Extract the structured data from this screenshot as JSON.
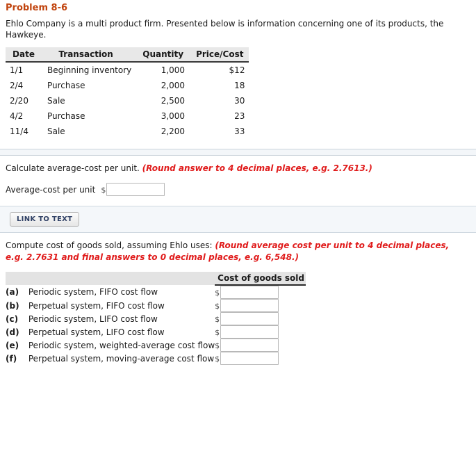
{
  "problem": {
    "title": "Problem 8-6",
    "intro": "Ehlo Company is a multi product firm. Presented below is information concerning one of its products, the Hawkeye."
  },
  "inventory_table": {
    "columns": [
      "Date",
      "Transaction",
      "Quantity",
      "Price/Cost"
    ],
    "rows": [
      {
        "date": "1/1",
        "transaction": "Beginning inventory",
        "quantity": "1,000",
        "price": "$12"
      },
      {
        "date": "2/4",
        "transaction": "Purchase",
        "quantity": "2,000",
        "price": "18"
      },
      {
        "date": "2/20",
        "transaction": "Sale",
        "quantity": "2,500",
        "price": "30"
      },
      {
        "date": "4/2",
        "transaction": "Purchase",
        "quantity": "3,000",
        "price": "23"
      },
      {
        "date": "11/4",
        "transaction": "Sale",
        "quantity": "2,200",
        "price": "33"
      }
    ]
  },
  "section_average": {
    "prompt": "Calculate average-cost per unit.",
    "hint": "(Round answer to 4 decimal places, e.g. 2.7613.)",
    "answer_label": "Average-cost per unit",
    "currency_symbol": "$",
    "answer_value": "",
    "answer_placeholder": ""
  },
  "link_to_text": {
    "button_label": "LINK TO TEXT"
  },
  "section_cogs": {
    "prompt": "Compute cost of goods sold, assuming Ehlo uses:",
    "hint": "(Round average cost per unit to 4 decimal places, e.g. 2.7631 and final answers to 0 decimal places, e.g. 6,548.)",
    "column_header": "Cost of goods sold",
    "currency_symbol": "$",
    "rows": [
      {
        "letter": "(a)",
        "description": "Periodic system, FIFO cost flow",
        "value": ""
      },
      {
        "letter": "(b)",
        "description": "Perpetual system, FIFO cost flow",
        "value": ""
      },
      {
        "letter": "(c)",
        "description": "Periodic system, LIFO cost flow",
        "value": ""
      },
      {
        "letter": "(d)",
        "description": "Perpetual system, LIFO cost flow",
        "value": ""
      },
      {
        "letter": "(e)",
        "description": "Periodic system, weighted-average cost flow",
        "value": ""
      },
      {
        "letter": "(f)",
        "description": "Perpetual system, moving-average cost flow",
        "value": ""
      }
    ]
  },
  "colors": {
    "title": "#c1440e",
    "hint_red": "#e01b1b",
    "header_gray": "#e8e8e8",
    "band_blue": "#f4f7fa",
    "button_text": "#2e3f64"
  }
}
